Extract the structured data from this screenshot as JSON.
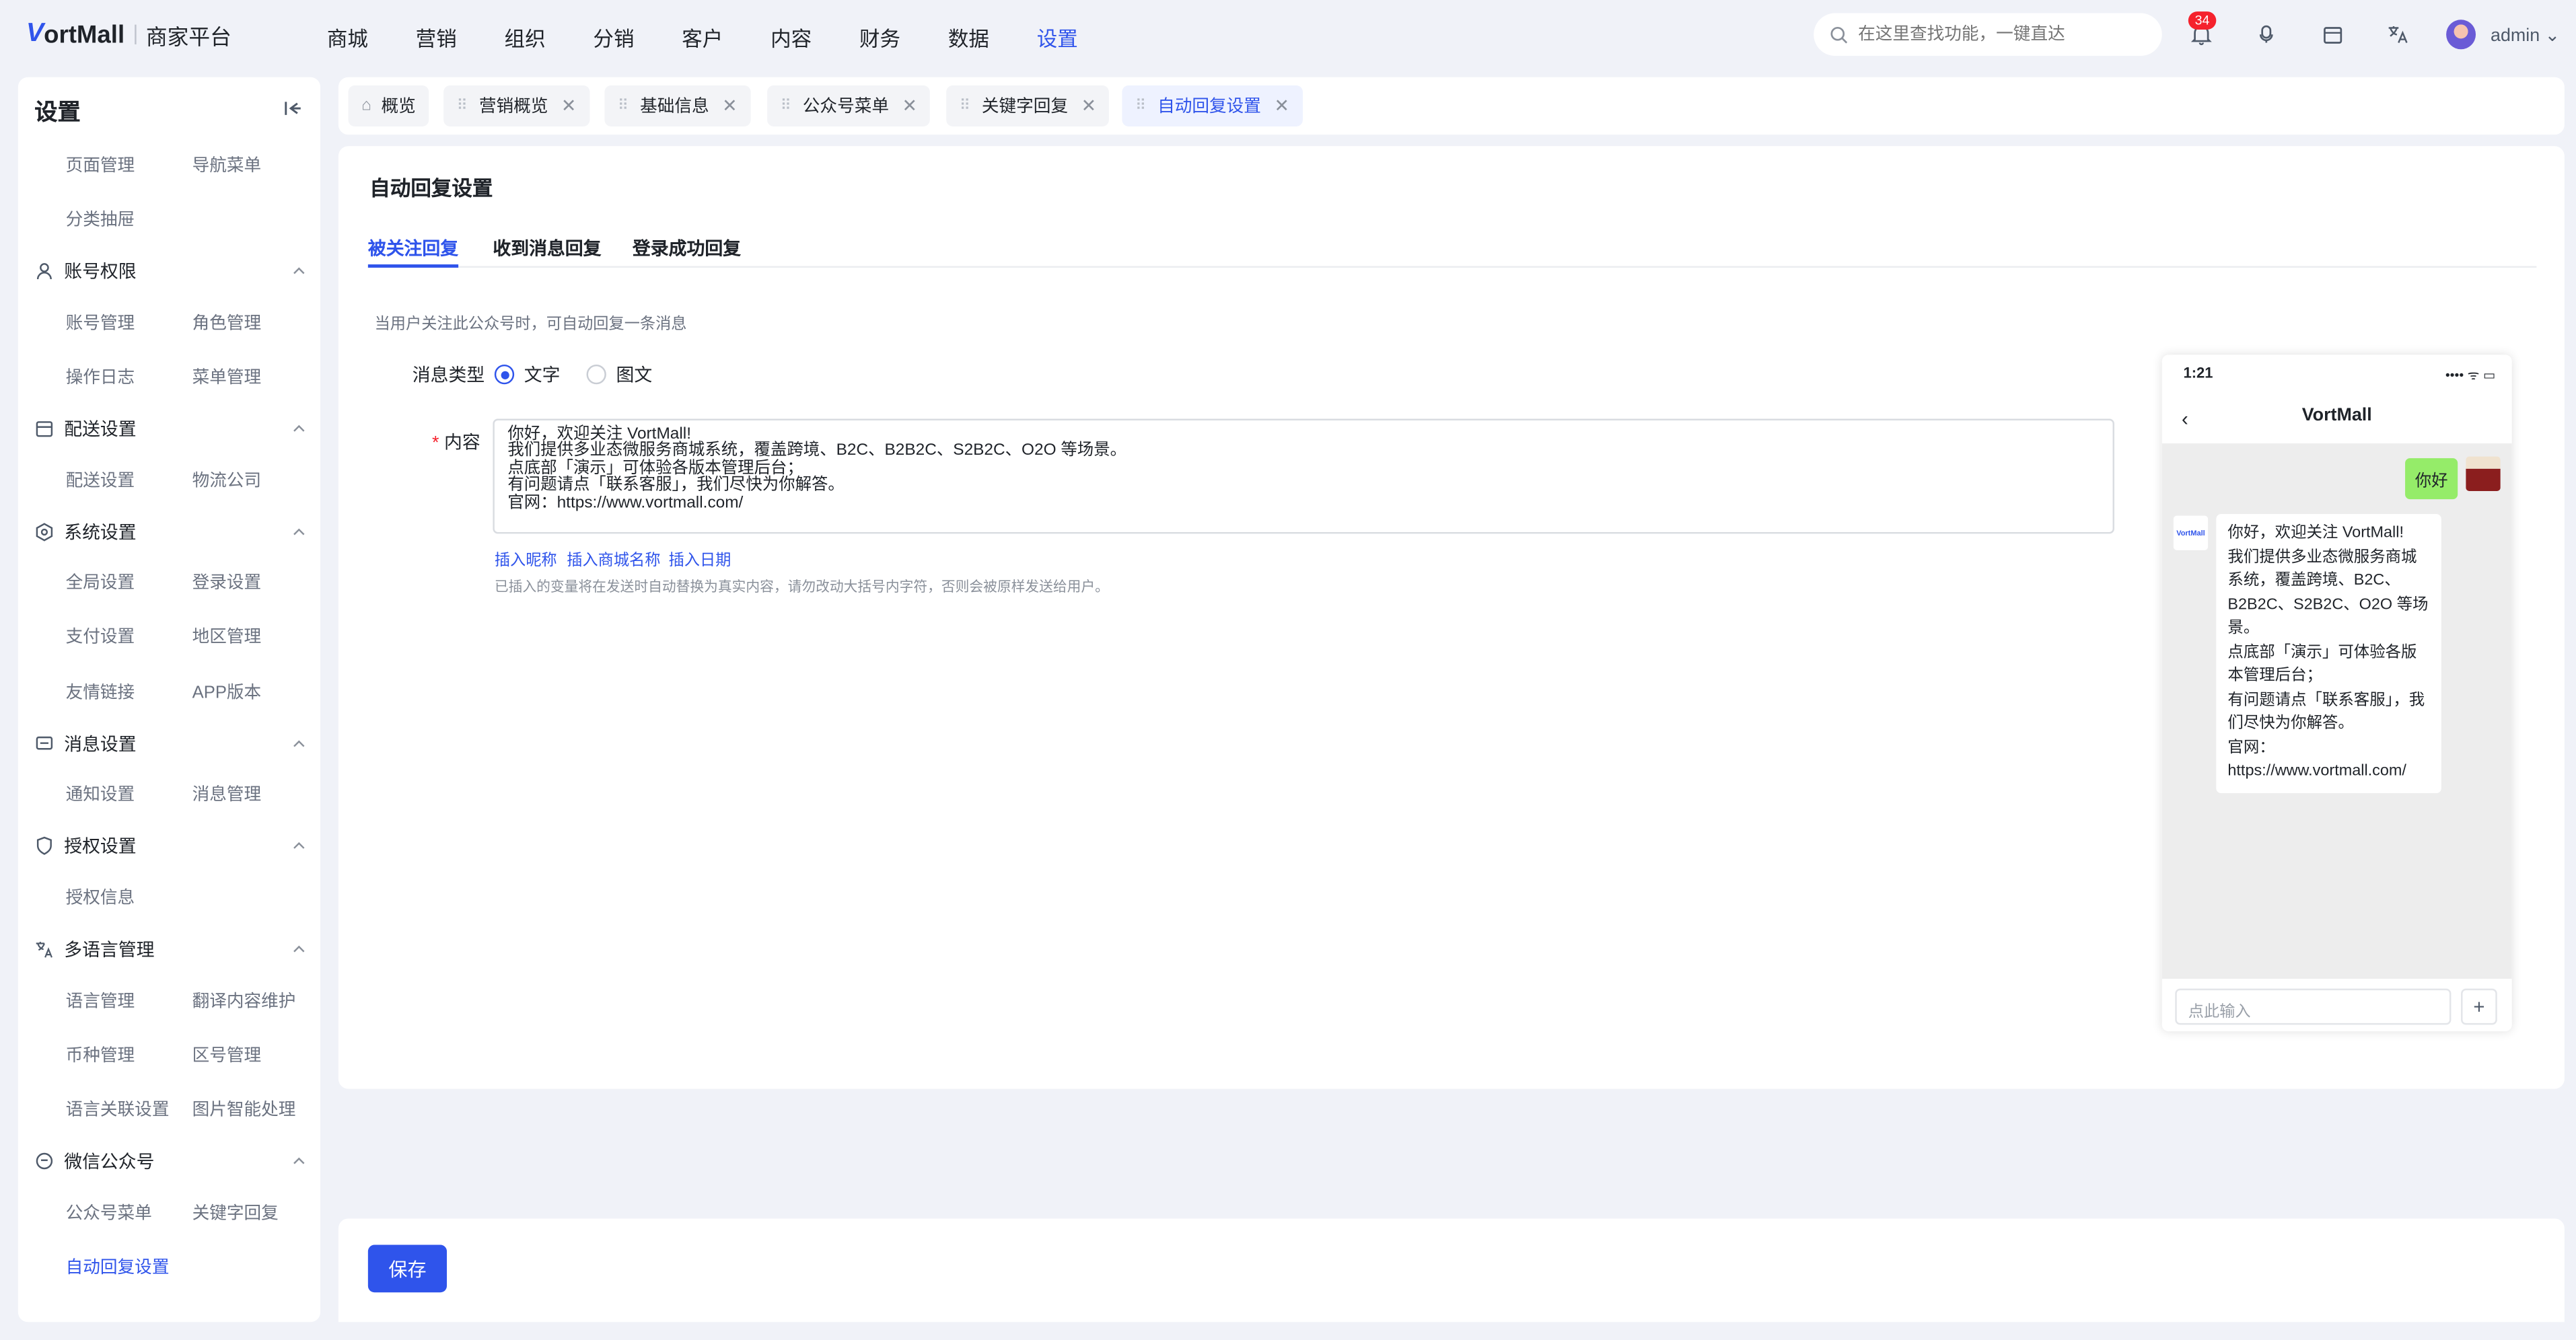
{
  "brand": {
    "logo_v": "V",
    "logo_text": "ortMall",
    "sub": "商家平台"
  },
  "nav": {
    "items": [
      "商城",
      "营销",
      "组织",
      "分销",
      "客户",
      "内容",
      "财务",
      "数据",
      "设置"
    ],
    "active": "设置"
  },
  "search": {
    "placeholder": "在这里查找功能，一键直达"
  },
  "notifications": {
    "count": "34"
  },
  "user": {
    "name": "admin"
  },
  "sidebar": {
    "title": "设置",
    "items": {
      "page_manage": "页面管理",
      "nav_menu": "导航菜单",
      "category_drawer": "分类抽屉",
      "account_perm": "账号权限",
      "account_manage": "账号管理",
      "role_manage": "角色管理",
      "op_log": "操作日志",
      "menu_manage": "菜单管理",
      "delivery_settings": "配送设置",
      "delivery_settings_item": "配送设置",
      "logistics": "物流公司",
      "system_settings": "系统设置",
      "global_settings": "全局设置",
      "login_settings": "登录设置",
      "payment_settings": "支付设置",
      "region_manage": "地区管理",
      "friend_links": "友情链接",
      "app_version": "APP版本",
      "message_settings": "消息设置",
      "notify_settings": "通知设置",
      "message_manage": "消息管理",
      "auth_settings": "授权设置",
      "auth_info": "授权信息",
      "multilang": "多语言管理",
      "language_manage": "语言管理",
      "translation": "翻译内容维护",
      "currency": "币种管理",
      "area_code": "区号管理",
      "lang_link": "语言关联设置",
      "image_ai": "图片智能处理",
      "wechat": "微信公众号",
      "wx_menu": "公众号菜单",
      "keyword_reply": "关键字回复",
      "auto_reply": "自动回复设置"
    }
  },
  "tabs": [
    {
      "label": "概览",
      "closable": false,
      "active": false
    },
    {
      "label": "营销概览",
      "closable": true,
      "active": false
    },
    {
      "label": "基础信息",
      "closable": true,
      "active": false
    },
    {
      "label": "公众号菜单",
      "closable": true,
      "active": false
    },
    {
      "label": "关键字回复",
      "closable": true,
      "active": false
    },
    {
      "label": "自动回复设置",
      "closable": true,
      "active": true
    }
  ],
  "page": {
    "title": "自动回复设置",
    "subtabs": [
      "被关注回复",
      "收到消息回复",
      "登录成功回复"
    ],
    "active_subtab": "被关注回复",
    "hint": "当用户关注此公众号时，可自动回复一条消息",
    "msg_type_label": "消息类型",
    "msg_type_options": [
      "文字",
      "图文"
    ],
    "msg_type_selected": "文字",
    "content_required": "*",
    "content_label": "内容",
    "content_value": "你好，欢迎关注 VortMall!\n我们提供多业态微服务商城系统，覆盖跨境、B2C、B2B2C、S2B2C、O2O 等场景。\n点底部「演示」可体验各版本管理后台；\n有问题请点「联系客服」，我们尽快为你解答。\n官网：https://www.vortmall.com/",
    "insert_links": [
      "插入昵称",
      "插入商城名称",
      "插入日期"
    ],
    "note": "已插入的变量将在发送时自动替换为真实内容，请勿改动大括号内字符，否则会被原样发送给用户。"
  },
  "preview": {
    "time": "1:21",
    "status": "•••• ᯤ ▭",
    "title": "VortMall",
    "user_msg": "你好",
    "bot_avatar": "VortMall",
    "bot_msg": "你好，欢迎关注 VortMall!\n我们提供多业态微服务商城系统，覆盖跨境、B2C、B2B2C、S2B2C、O2O 等场景。\n点底部「演示」可体验各版本管理后台；\n有问题请点「联系客服」，我们尽快为你解答。\n官网：https://www.vortmall.com/",
    "input_placeholder": "点此输入",
    "plus": "+"
  },
  "footer": {
    "save_label": "保存"
  },
  "colors": {
    "accent": "#2f54eb",
    "badge": "#f5222d",
    "chat_me": "#95ec69"
  }
}
